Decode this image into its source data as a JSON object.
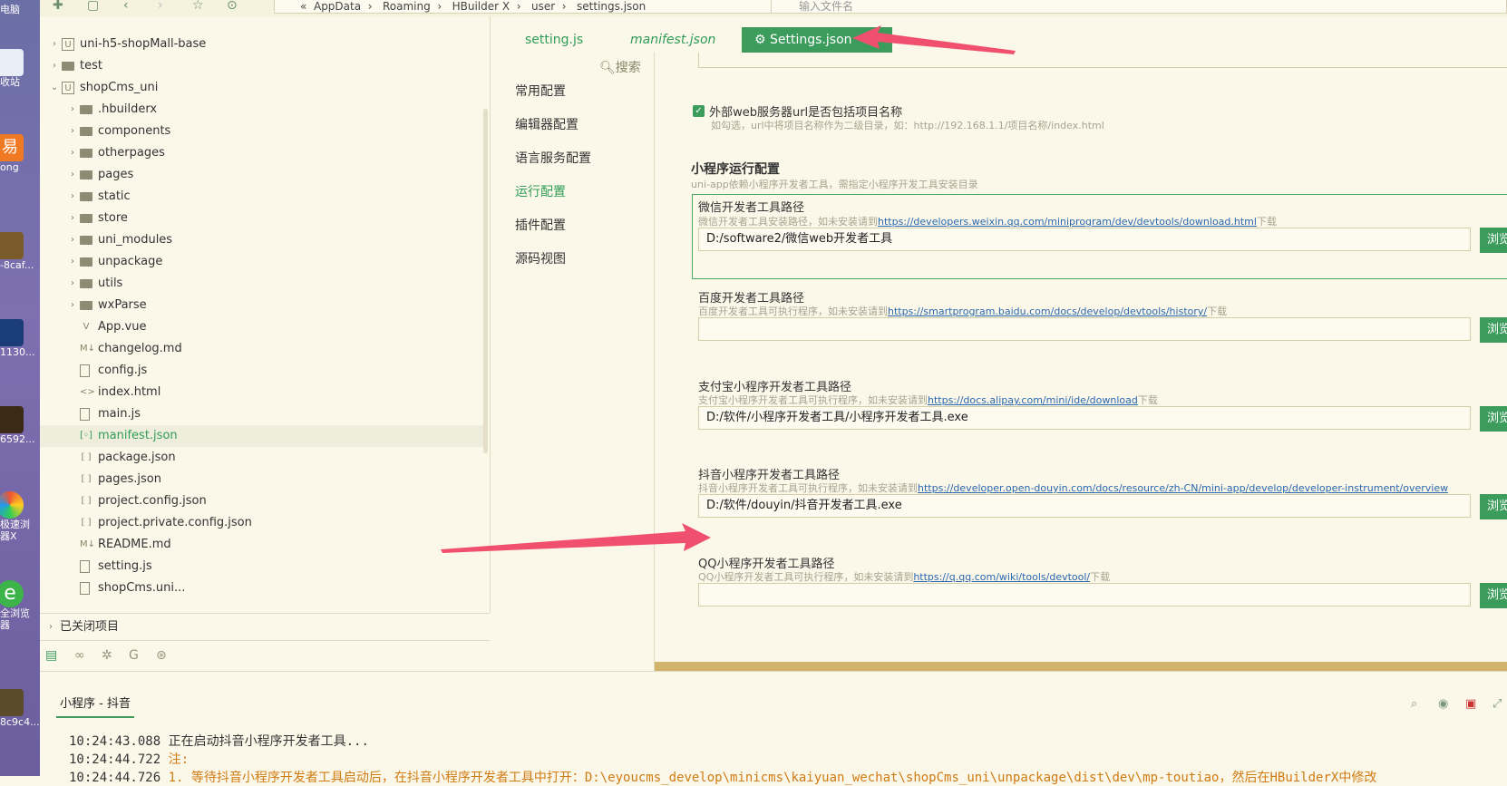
{
  "desktop": {
    "labels": [
      "电脑",
      "收站",
      "ong",
      "-8caf...",
      "1130...",
      "6592...",
      "极速浏\n器X",
      "全浏览\n器",
      "8c9c4..."
    ],
    "badge": "易"
  },
  "toolbar": {
    "path": [
      "AppData",
      "Roaming",
      "HBuilder X",
      "user",
      "settings.json"
    ],
    "path_prefix": "«",
    "file_search_placeholder": "输入文件名"
  },
  "tree": [
    {
      "label": "uni-h5-shopMall-base",
      "level": 0,
      "arrow": "›",
      "icon": "project"
    },
    {
      "label": "test",
      "level": 0,
      "arrow": "›",
      "icon": "folder"
    },
    {
      "label": "shopCms_uni",
      "level": 0,
      "arrow": "⌄",
      "icon": "project"
    },
    {
      "label": ".hbuilderx",
      "level": 1,
      "arrow": "›",
      "icon": "folder"
    },
    {
      "label": "components",
      "level": 1,
      "arrow": "›",
      "icon": "folder"
    },
    {
      "label": "otherpages",
      "level": 1,
      "arrow": "›",
      "icon": "folder"
    },
    {
      "label": "pages",
      "level": 1,
      "arrow": "›",
      "icon": "folder"
    },
    {
      "label": "static",
      "level": 1,
      "arrow": "›",
      "icon": "folder"
    },
    {
      "label": "store",
      "level": 1,
      "arrow": "›",
      "icon": "folder"
    },
    {
      "label": "uni_modules",
      "level": 1,
      "arrow": "›",
      "icon": "folder"
    },
    {
      "label": "unpackage",
      "level": 1,
      "arrow": "›",
      "icon": "folder"
    },
    {
      "label": "utils",
      "level": 1,
      "arrow": "›",
      "icon": "folder"
    },
    {
      "label": "wxParse",
      "level": 1,
      "arrow": "›",
      "icon": "folder"
    },
    {
      "label": "App.vue",
      "level": 1,
      "arrow": "",
      "icon": "vue"
    },
    {
      "label": "changelog.md",
      "level": 1,
      "arrow": "",
      "icon": "md"
    },
    {
      "label": "config.js",
      "level": 1,
      "arrow": "",
      "icon": "js"
    },
    {
      "label": "index.html",
      "level": 1,
      "arrow": "",
      "icon": "html"
    },
    {
      "label": "main.js",
      "level": 1,
      "arrow": "",
      "icon": "js"
    },
    {
      "label": "manifest.json",
      "level": 1,
      "arrow": "",
      "icon": "manifest",
      "selected": true
    },
    {
      "label": "package.json",
      "level": 1,
      "arrow": "",
      "icon": "json"
    },
    {
      "label": "pages.json",
      "level": 1,
      "arrow": "",
      "icon": "json"
    },
    {
      "label": "project.config.json",
      "level": 1,
      "arrow": "",
      "icon": "json"
    },
    {
      "label": "project.private.config.json",
      "level": 1,
      "arrow": "",
      "icon": "json"
    },
    {
      "label": "README.md",
      "level": 1,
      "arrow": "",
      "icon": "md"
    },
    {
      "label": "setting.js",
      "level": 1,
      "arrow": "",
      "icon": "js"
    },
    {
      "label": "shopCms.uni...",
      "level": 1,
      "arrow": "",
      "icon": "js"
    }
  ],
  "closed_projects": "已关闭项目",
  "tabs": [
    {
      "label": "setting.js",
      "active": false
    },
    {
      "label": "manifest.json",
      "active": false,
      "italic": true
    },
    {
      "label": "Settings.json",
      "active": true,
      "close": "×"
    }
  ],
  "settings": {
    "search": "搜索",
    "nav": [
      "常用配置",
      "编辑器配置",
      "语言服务配置",
      "运行配置",
      "插件配置",
      "源码视图"
    ],
    "active_nav": 3,
    "webserver_checkbox": "外部web服务器url是否包括项目名称",
    "webserver_hint": "如勾选，url中将项目名称作为二级目录，如：http://192.168.1.1/项目名称/index.html",
    "section_title": "小程序运行配置",
    "section_hint": "uni-app依赖小程序开发者工具，需指定小程序开发工具安装目录",
    "browse_label": "浏览",
    "download_suffix": "下载",
    "tools": [
      {
        "label": "微信开发者工具路径",
        "hint": "微信开发者工具安装路径，如未安装请到",
        "link": "https://developers.weixin.qq.com/miniprogram/dev/devtools/download.html",
        "value": "D:/software2/微信web开发者工具"
      },
      {
        "label": "百度开发者工具路径",
        "hint": "百度开发者工具可执行程序，如未安装请到",
        "link": "https://smartprogram.baidu.com/docs/develop/devtools/history/",
        "value": ""
      },
      {
        "label": "支付宝小程序开发者工具路径",
        "hint": "支付宝小程序开发者工具可执行程序，如未安装请到",
        "link": "https://docs.alipay.com/mini/ide/download",
        "value": "D:/软件/小程序开发者工具/小程序开发者工具.exe"
      },
      {
        "label": "抖音小程序开发者工具路径",
        "hint": "抖音小程序开发者工具可执行程序，如未安装请到",
        "link": "https://developer.open-douyin.com/docs/resource/zh-CN/mini-app/develop/developer-instrument/overview",
        "value": "D:/软件/douyin/抖音开发者工具.exe"
      },
      {
        "label": "QQ小程序开发者工具路径",
        "hint": "QQ小程序开发者工具可执行程序，如未安装请到",
        "link": "https://q.qq.com/wiki/tools/devtool/",
        "value": ""
      }
    ]
  },
  "console": {
    "tab": "小程序 - 抖音",
    "lines": [
      {
        "time": "10:24:43.088",
        "text": "正在启动抖音小程序开发者工具...",
        "warn": false
      },
      {
        "time": "10:24:44.722",
        "text": "注:",
        "warn": true
      },
      {
        "time": "10:24:44.726",
        "text": "1. 等待抖音小程序开发者工具启动后，在抖音小程序开发者工具中打开：D:\\eyoucms_develop\\minicms\\kaiyuan_wechat\\shopCms_uni\\unpackage\\dist\\dev\\mp-toutiao，然后在HBuilderX中修改",
        "warn": true
      }
    ]
  },
  "colors": {
    "accent": "#3c9c5c",
    "link": "#2a67b0",
    "warn": "#d07a12",
    "annotation_arrow": "#f0506e"
  }
}
